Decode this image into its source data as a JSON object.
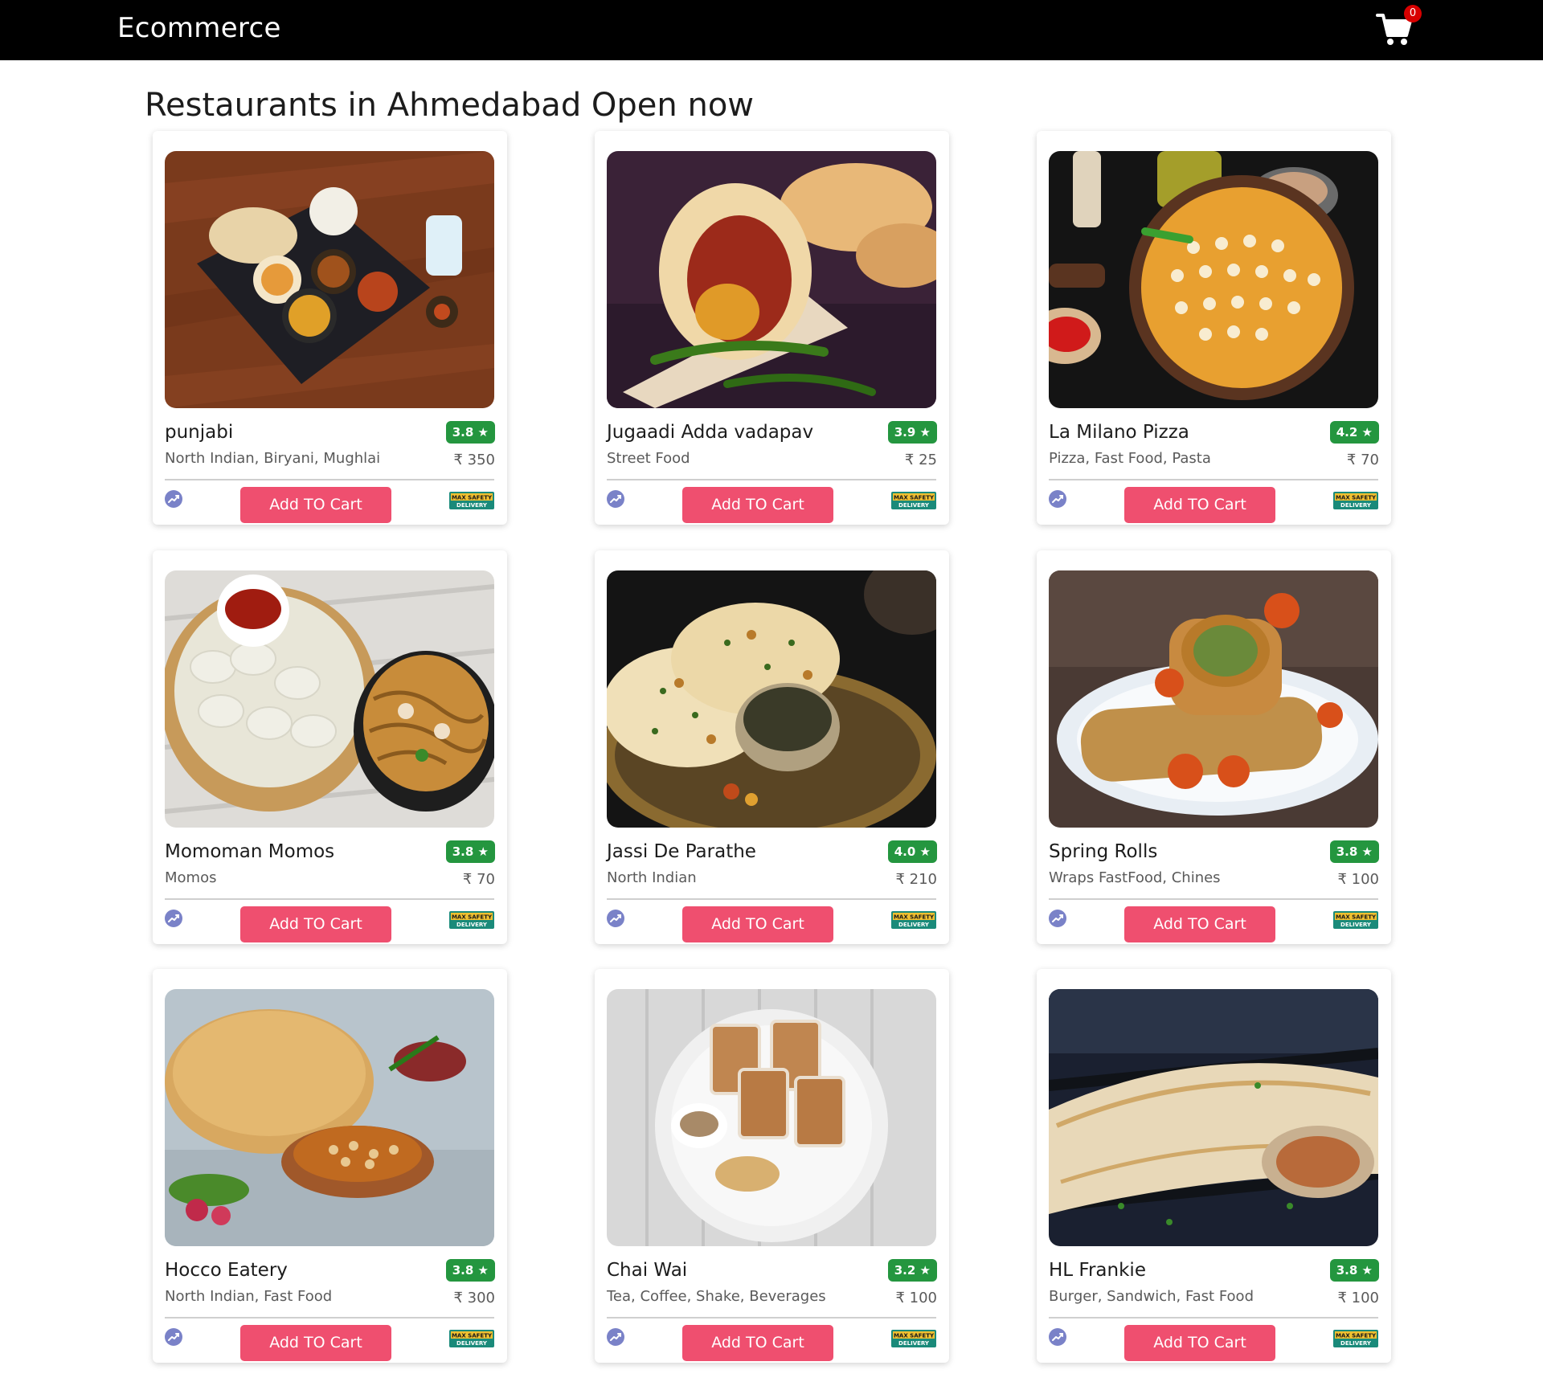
{
  "navbar": {
    "brand": "Ecommerce",
    "cart_count": "0",
    "cart_icon": "shopping-cart-icon"
  },
  "page": {
    "heading": "Restaurants in Ahmedabad Open now"
  },
  "card_common": {
    "button_label": "Add TO Cart",
    "safety_badge_line1": "MAX SAFETY",
    "safety_badge_line2": "DELIVERY",
    "trend_icon": "trending-up-icon",
    "star": "★",
    "currency": "₹"
  },
  "colors": {
    "navbar_bg": "#000000",
    "badge": "#d80000",
    "rating_bg": "#24963f",
    "button_bg": "#ef4f6f"
  },
  "restaurants": [
    {
      "name": "punjabi",
      "rating": "3.8",
      "cuisine": "North Indian, Biryani, Mughlai",
      "price": "350",
      "photo": "thali-plate"
    },
    {
      "name": "Jugaadi Adda vadapav",
      "rating": "3.9",
      "cuisine": "Street Food",
      "price": "25",
      "photo": "vada-pav"
    },
    {
      "name": "La Milano Pizza",
      "rating": "4.2",
      "cuisine": "Pizza, Fast Food, Pasta",
      "price": "70",
      "photo": "pizza"
    },
    {
      "name": "Momoman Momos",
      "rating": "3.8",
      "cuisine": "Momos",
      "price": "70",
      "photo": "momos-noodles"
    },
    {
      "name": "Jassi De Parathe",
      "rating": "4.0",
      "cuisine": "North Indian",
      "price": "210",
      "photo": "parathe"
    },
    {
      "name": "Spring Rolls",
      "rating": "3.8",
      "cuisine": "Wraps FastFood, Chines",
      "price": "100",
      "photo": "wrap-roll"
    },
    {
      "name": "Hocco Eatery",
      "rating": "3.8",
      "cuisine": "North Indian, Fast Food",
      "price": "300",
      "photo": "chole-bhature"
    },
    {
      "name": "Chai Wai",
      "rating": "3.2",
      "cuisine": "Tea, Coffee, Shake, Beverages",
      "price": "100",
      "photo": "chai-glasses"
    },
    {
      "name": "HL Frankie",
      "rating": "3.8",
      "cuisine": "Burger, Sandwich, Fast Food",
      "price": "100",
      "photo": "frankie"
    }
  ]
}
